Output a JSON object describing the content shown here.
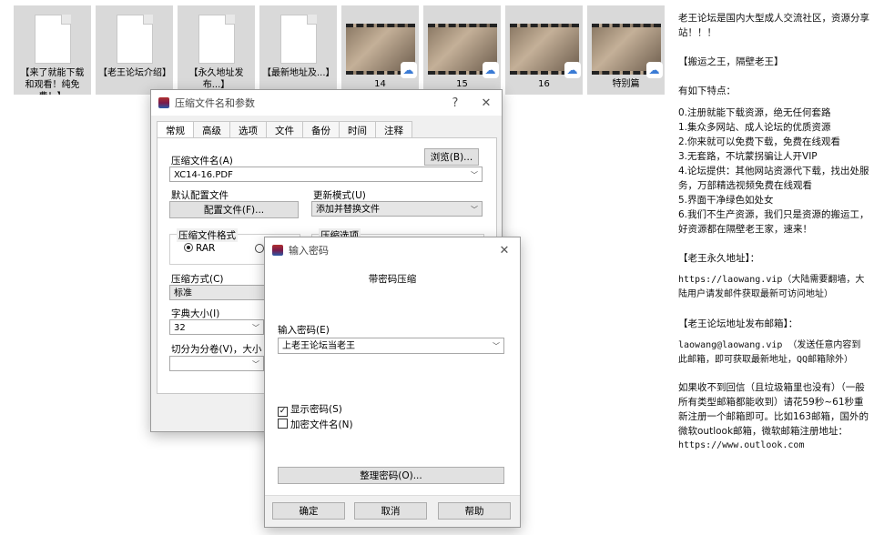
{
  "files": [
    {
      "type": "doc",
      "label": "【来了就能下载和观看！纯免费！】"
    },
    {
      "type": "doc",
      "label": "【老王论坛介绍】"
    },
    {
      "type": "doc",
      "label": "【永久地址发布...】"
    },
    {
      "type": "doc",
      "label": "【最新地址及...】"
    },
    {
      "type": "video",
      "label": "14"
    },
    {
      "type": "video",
      "label": "15"
    },
    {
      "type": "video",
      "label": "16"
    },
    {
      "type": "video",
      "label": "特别篇"
    }
  ],
  "archive_dialog": {
    "title": "压缩文件名和参数",
    "help_btn": "?",
    "close_btn": "✕",
    "tabs": [
      "常规",
      "高级",
      "选项",
      "文件",
      "备份",
      "时间",
      "注释"
    ],
    "filename_label": "压缩文件名(A)",
    "browse_btn": "浏览(B)...",
    "filename_value": "XC14-16.PDF",
    "profile_label": "默认配置文件",
    "profile_btn": "配置文件(F)...",
    "update_label": "更新模式(U)",
    "update_value": "添加并替换文件",
    "format_group": "压缩文件格式",
    "format_rar": "RAR",
    "options_group": "压缩选项",
    "method_label": "压缩方式(C)",
    "method_value": "标准",
    "dict_label": "字典大小(I)",
    "dict_value": "32",
    "split_label": "切分为分卷(V)，大小"
  },
  "password_dialog": {
    "title": "输入密码",
    "close_btn": "✕",
    "heading": "带密码压缩",
    "pw_label": "输入密码(E)",
    "pw_value": "上老王论坛当老王",
    "show_pw": "显示密码(S)",
    "show_pw_mark": "✓",
    "encrypt_names": "加密文件名(N)",
    "organize_btn": "整理密码(O)...",
    "ok_btn": "确定",
    "cancel_btn": "取消",
    "help_btn": "帮助"
  },
  "article": {
    "intro": "老王论坛是国内大型成人交流社区，资源分享站！！！",
    "slogan": "【搬运之王，隔壁老王】",
    "features_title": "有如下特点：",
    "features": [
      "0.注册就能下载资源，绝无任何套路",
      "1.集众多网站、成人论坛的优质资源",
      "2.你来就可以免费下载，免费在线观看",
      "3.无套路，不坑蒙拐骗让人开VIP",
      "4.论坛提供：其他网站资源代下载，找出处服务，万部精选视频免费在线观看",
      "5.界面干净绿色如处女",
      "6.我们不生产资源，我们只是资源的搬运工，好资源都在隔壁老王家，速来！"
    ],
    "permanent_title": "【老王永久地址】：",
    "permanent_text": "https://laowang.vip（大陆需要翻墙，大陆用户请发邮件获取最新可访问地址）",
    "mail_title": "【老王论坛地址发布邮箱】：",
    "mail_text": "laowang@laowang.vip （发送任意内容到此邮箱，即可获取最新地址，QQ邮箱除外）",
    "note_text": "如果收不到回信（且垃圾箱里也没有）（一般所有类型邮箱都能收到）请花59秒~61秒重新注册一个邮箱即可。比如163邮箱，国外的微软outlook邮箱，微软邮箱注册地址：",
    "outlook_url": "https://www.outlook.com"
  }
}
